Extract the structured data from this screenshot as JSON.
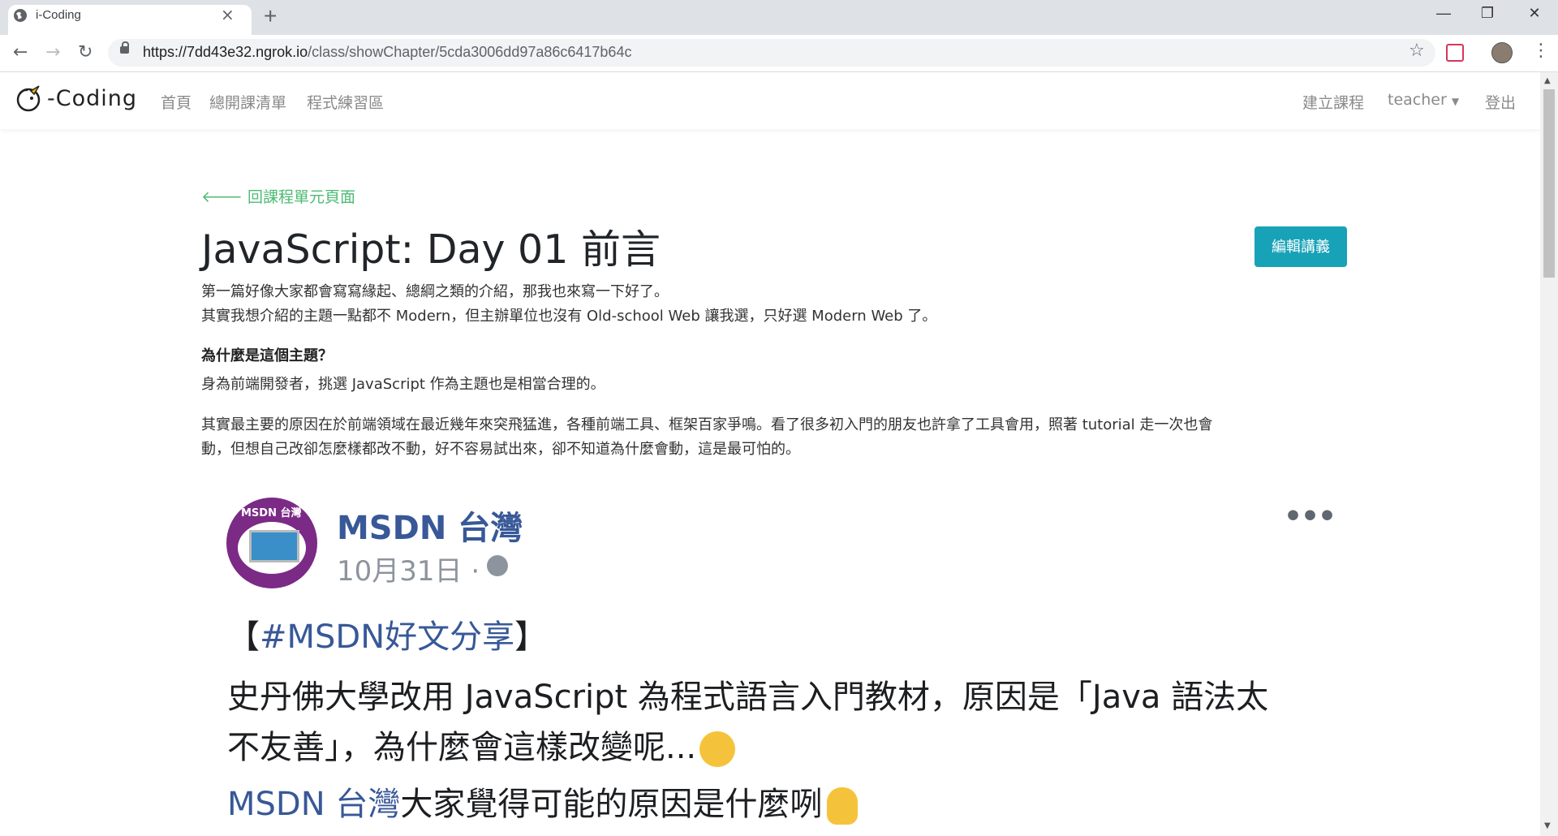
{
  "browser": {
    "tab_title": "i-Coding",
    "new_tab_symbol": "+",
    "url_host": "https://7dd43e32.ngrok.io",
    "url_path": "/class/showChapter/5cda3006dd97a86c6417b64c"
  },
  "navbar": {
    "logo_text": "-Coding",
    "links": [
      "首頁",
      "總開課清單",
      "程式練習區"
    ],
    "create_course": "建立課程",
    "user": "teacher",
    "logout": "登出"
  },
  "content": {
    "back_link": "回課程單元頁面",
    "title": "JavaScript: Day 01 前言",
    "edit_button": "編輯講義",
    "para1_line1": "第一篇好像大家都會寫寫緣起、總綱之類的介紹，那我也來寫一下好了。",
    "para1_line2": "其實我想介紹的主題一點都不 Modern，但主辦單位也沒有 Old-school Web 讓我選，只好選 Modern Web 了。",
    "heading": "為什麼是這個主題？",
    "para2": "身為前端開發者，挑選 JavaScript 作為主題也是相當合理的。",
    "para3_line1": "其實最主要的原因在於前端領域在最近幾年來突飛猛進，各種前端工具、框架百家爭鳴。看了很多初入門的朋友也許拿了工具會用，照著 tutorial 走一次也會",
    "para3_line2": "動，但想自己改卻怎麼樣都改不動，好不容易試出來，卻不知道為什麼會動，這是最可怕的。"
  },
  "post": {
    "avatar_label": "MSDN 台灣",
    "page_name": "MSDN 台灣",
    "date": "10月31日 ·",
    "more": "•••",
    "hashtag_line_open": "【",
    "hashtag": "#MSDN好文分享",
    "hashtag_line_close": "】",
    "body_line1": "史丹佛大學改用 JavaScript 為程式語言入門教材，原因是「Java 語法太",
    "body_line2": "不友善」，為什麼會這樣改變呢...",
    "mention": "MSDN 台灣",
    "question": "大家覺得可能的原因是什麼咧"
  }
}
